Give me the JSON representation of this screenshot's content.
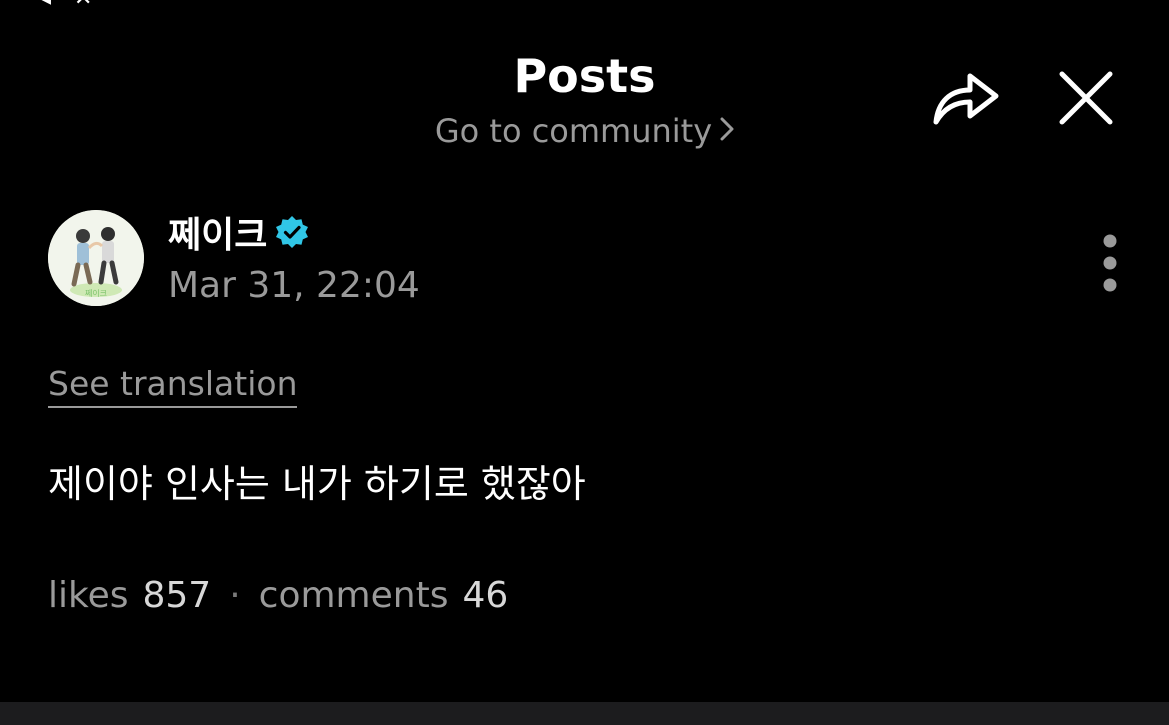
{
  "header": {
    "title": "Posts",
    "community_link": "Go to community",
    "share_icon": "share-icon",
    "close_icon": "close-icon"
  },
  "post": {
    "author": "쩨이크",
    "verified": true,
    "date": "Mar 31, 22:04",
    "see_translation": "See translation",
    "body": "제이야 인사는 내가 하기로 했잖아",
    "likes_label": "likes",
    "likes_count": "857",
    "separator": "·",
    "comments_label": "comments",
    "comments_count": "46"
  },
  "colors": {
    "background": "#000000",
    "muted_text": "#9a9a9a",
    "verified_badge": "#30c6e6"
  }
}
